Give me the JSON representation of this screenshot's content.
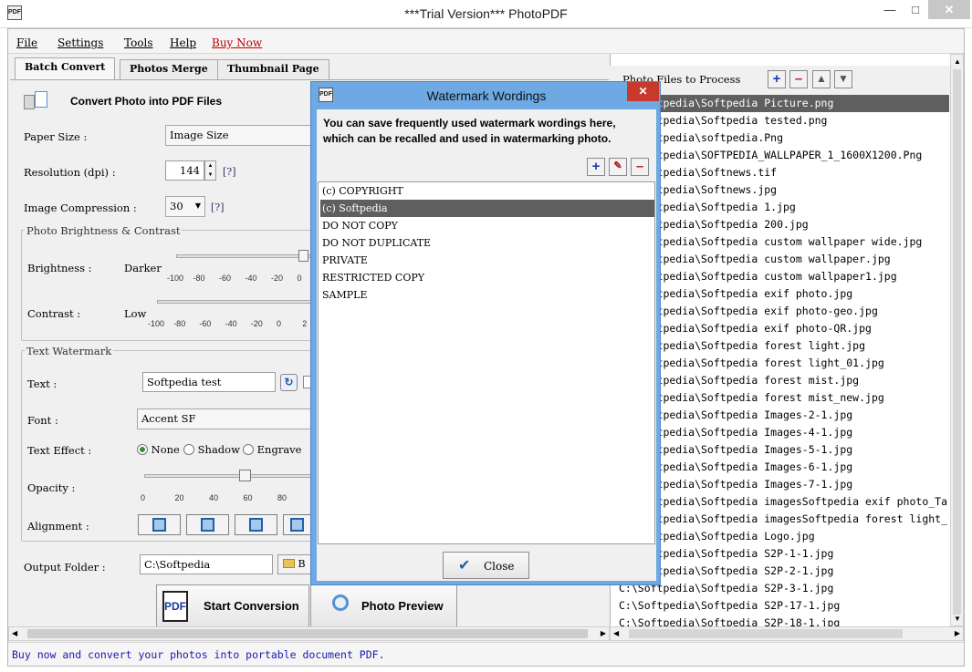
{
  "window": {
    "title": "***Trial Version*** PhotoPDF",
    "app_icon": "PDF"
  },
  "menu": [
    {
      "label": "File"
    },
    {
      "label": "Settings"
    },
    {
      "label": "Tools"
    },
    {
      "label": "Help"
    },
    {
      "label": "Buy Now",
      "color": "#c00000"
    }
  ],
  "tabs": [
    "Batch Convert",
    "Photos Merge",
    "Thumbnail Page"
  ],
  "batch": {
    "heading": "Convert Photo into PDF Files",
    "paper_size_label": "Paper Size :",
    "paper_size_value": "Image Size",
    "resolution_label": "Resolution (dpi) :",
    "resolution_value": "144",
    "help_link": "[?]",
    "compression_label": "Image Compression :",
    "compression_value": "30",
    "brightness_group": "Photo Brightness & Contrast",
    "brightness_label": "Brightness :",
    "brightness_low": "Darker",
    "brightness_ticks": [
      "-100",
      "-80",
      "-60",
      "-40",
      "-20",
      "0"
    ],
    "contrast_label": "Contrast :",
    "contrast_low": "Low",
    "contrast_ticks": [
      "-100",
      "-80",
      "-60",
      "-40",
      "-20",
      "0",
      "2"
    ],
    "watermark_group": "Text Watermark",
    "text_label": "Text :",
    "text_value": "Softpedia test",
    "font_label": "Font :",
    "font_value": "Accent SF",
    "effect_label": "Text Effect :",
    "effect_options": [
      "None",
      "Shadow",
      "Engrave"
    ],
    "opacity_label": "Opacity :",
    "opacity_ticks": [
      "0",
      "20",
      "40",
      "60",
      "80",
      "1"
    ],
    "opacity_value": 60,
    "alignment_label": "Alignment :",
    "output_label": "Output Folder :",
    "output_value": "C:\\Softpedia",
    "browse_label": "B",
    "start_label": "Start Conversion",
    "preview_label": "Photo Preview"
  },
  "files": {
    "header": "Photo Files to Process",
    "items": [
      "C:\\Softpedia\\Softpedia Picture.png",
      "C:\\Softpedia\\Softpedia tested.png",
      "C:\\Softpedia\\softpedia.Png",
      "C:\\Softpedia\\SOFTPEDIA_WALLPAPER_1_1600X1200.Png",
      "C:\\Softpedia\\Softnews.tif",
      "C:\\Softpedia\\Softnews.jpg",
      "C:\\Softpedia\\Softpedia 1.jpg",
      "C:\\Softpedia\\Softpedia 200.jpg",
      "C:\\Softpedia\\Softpedia custom wallpaper wide.jpg",
      "C:\\Softpedia\\Softpedia custom wallpaper.jpg",
      "C:\\Softpedia\\Softpedia custom wallpaper1.jpg",
      "C:\\Softpedia\\Softpedia exif photo.jpg",
      "C:\\Softpedia\\Softpedia exif photo-geo.jpg",
      "C:\\Softpedia\\Softpedia exif photo-QR.jpg",
      "C:\\Softpedia\\Softpedia forest light.jpg",
      "C:\\Softpedia\\Softpedia forest light_01.jpg",
      "C:\\Softpedia\\Softpedia forest mist.jpg",
      "C:\\Softpedia\\Softpedia forest mist_new.jpg",
      "C:\\Softpedia\\Softpedia Images-2-1.jpg",
      "C:\\Softpedia\\Softpedia Images-4-1.jpg",
      "C:\\Softpedia\\Softpedia Images-5-1.jpg",
      "C:\\Softpedia\\Softpedia Images-6-1.jpg",
      "C:\\Softpedia\\Softpedia Images-7-1.jpg",
      "C:\\Softpedia\\Softpedia imagesSoftpedia exif photo_Ta",
      "C:\\Softpedia\\Softpedia imagesSoftpedia forest light_",
      "C:\\Softpedia\\Softpedia Logo.jpg",
      "C:\\Softpedia\\Softpedia S2P-1-1.jpg",
      "C:\\Softpedia\\Softpedia S2P-2-1.jpg",
      "C:\\Softpedia\\Softpedia S2P-3-1.jpg",
      "C:\\Softpedia\\Softpedia S2P-17-1.jpg",
      "C:\\Softpedia\\Softpedia S2P-18-1.jpg"
    ],
    "selected_index": 0
  },
  "dialog": {
    "title": "Watermark Wordings",
    "description": "You can save frequently used watermark wordings here, which can be recalled and used in watermarking photo.",
    "items": [
      "(c) COPYRIGHT",
      "(c) Softpedia",
      "DO NOT COPY",
      "DO NOT DUPLICATE",
      "PRIVATE",
      "RESTRICTED COPY",
      "SAMPLE"
    ],
    "selected_index": 1,
    "close_label": "Close"
  },
  "status": "Buy now and convert your photos into portable document PDF."
}
